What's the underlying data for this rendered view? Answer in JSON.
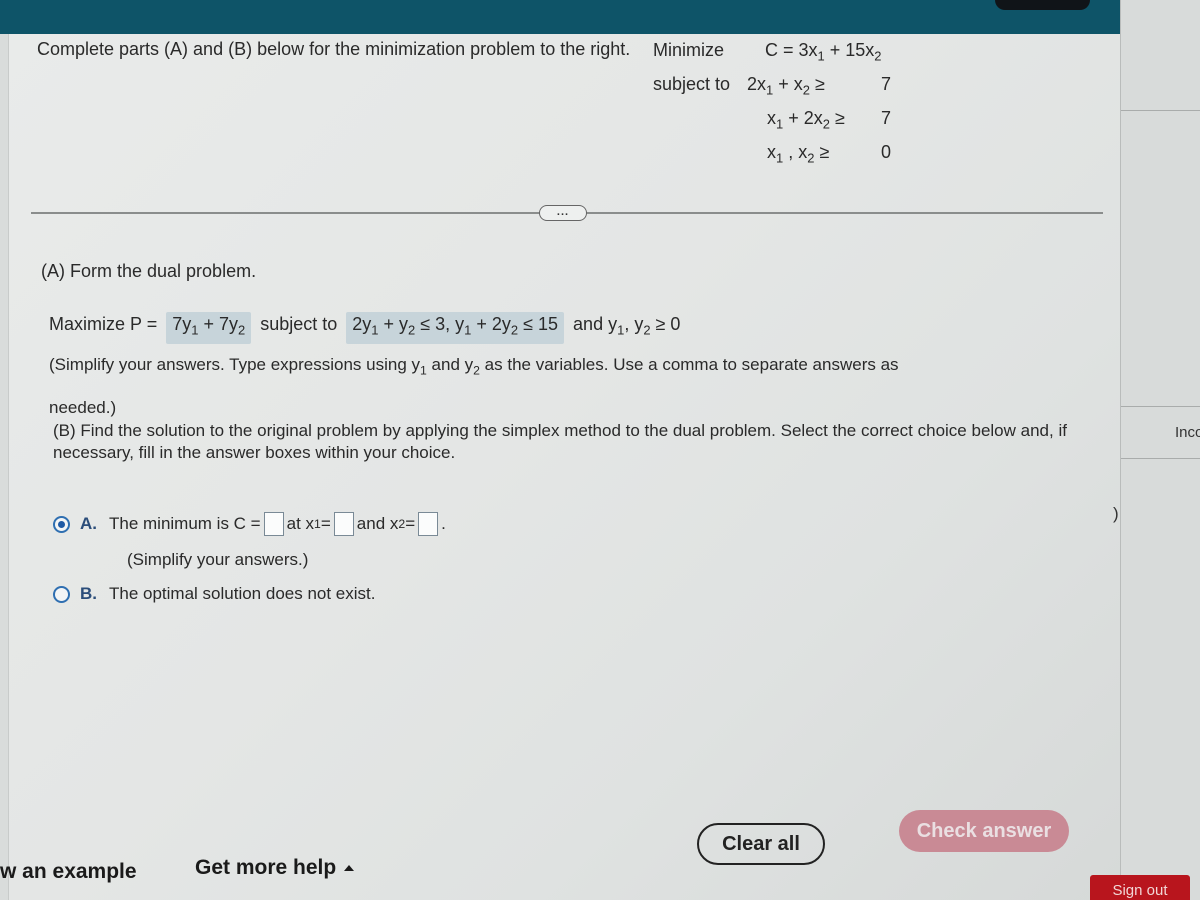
{
  "header": {
    "intro": "Complete parts (A) and (B) below for the minimization problem to the right."
  },
  "problem": {
    "minimize_label": "Minimize",
    "objective": {
      "lhs": "C = 3x",
      "s1": "1",
      "mid": " + 15x",
      "s2": "2"
    },
    "subject_to_label": "subject to",
    "constraints": [
      {
        "a": "2x",
        "sa": "1",
        "op": " +  x",
        "sb": "2",
        "rel": "≥",
        "rhs": "7"
      },
      {
        "a": "x",
        "sa": "1",
        "op": " + 2x",
        "sb": "2",
        "rel": "≥",
        "rhs": "7"
      },
      {
        "a": "x",
        "sa": "1",
        "op": " ,  x",
        "sb": "2",
        "rel": "≥",
        "rhs": "0"
      }
    ]
  },
  "expand_button": "...",
  "partA": {
    "title": "(A) Form the dual problem.",
    "maximize_label": "Maximize P =",
    "objective_answer": {
      "t1": "7y",
      "s1": "1",
      "t2": " + 7y",
      "s2": "2"
    },
    "subject_to_label": "subject to",
    "constraints_answer": {
      "t1": "2y",
      "s1": "1",
      "t2": " + y",
      "s2": "2",
      "t3": " ≤ 3, y",
      "s3": "1",
      "t4": " + 2y",
      "s4": "2",
      "t5": " ≤ 15"
    },
    "nonneg": {
      "and": "and y",
      "s1": "1",
      "mid": ", y",
      "s2": "2",
      "end": " ≥ 0"
    },
    "instruction_pre": "(Simplify your answers. Type expressions using y",
    "instruction_s1": "1",
    "instruction_mid": " and y",
    "instruction_s2": "2",
    "instruction_post": " as the variables. Use a comma to separate answers as",
    "instruction_line2": "needed.)"
  },
  "partB": {
    "prompt": "(B) Find the solution to the original problem by applying the simplex method to the dual problem. Select the correct choice below and, if necessary, fill in the answer boxes within your choice.",
    "choices": [
      {
        "letter": "A.",
        "selected": true,
        "text_pre": "The minimum is C =",
        "text_at": "at x",
        "sub1": "1",
        "eq1": " =",
        "text_and": "and x",
        "sub2": "2",
        "eq2": " =",
        "end": ".",
        "values": {
          "C": "",
          "x1": "",
          "x2": ""
        },
        "note": "(Simplify your answers.)"
      },
      {
        "letter": "B.",
        "selected": false,
        "text": "The optimal solution does not exist."
      }
    ]
  },
  "footer": {
    "view_example": "w an example",
    "get_more_help": "Get more help",
    "clear_all": "Clear all",
    "check_answer": "Check answer",
    "sign_out": "Sign out"
  },
  "right_panel": {
    "label": "Inco",
    "paren": ")"
  },
  "colors": {
    "top_bar": "#0e5468",
    "check_answer_bg": "#c98a95",
    "sign_out_bg": "#b8151d",
    "radio_selected": "#1f5aa5",
    "answer_highlight": "#c7d4da"
  }
}
